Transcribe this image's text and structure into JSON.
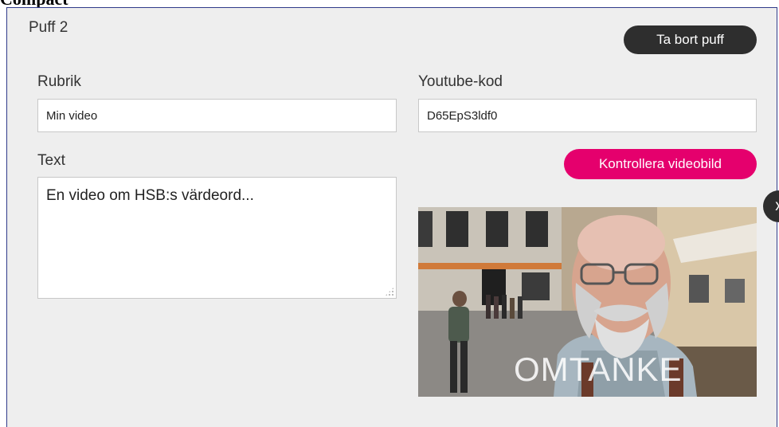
{
  "page_heading": "Compact",
  "puff": {
    "title": "Puff 2",
    "remove_button": "Ta bort puff",
    "rubrik_label": "Rubrik",
    "rubrik_value": "Min video",
    "youtube_label": "Youtube-kod",
    "youtube_value": "D65EpS3ldf0",
    "text_label": "Text",
    "text_value": "En video om HSB:s värdeord...",
    "check_button": "Kontrollera videobild",
    "video_caption": "OMTANKE",
    "close_label": "x"
  },
  "colors": {
    "panel_bg": "#eeeeee",
    "dark_button": "#2e2e2e",
    "accent_pink": "#e5006d"
  },
  "icons": {
    "close": "close-icon",
    "resize": "resize-grip-icon"
  }
}
